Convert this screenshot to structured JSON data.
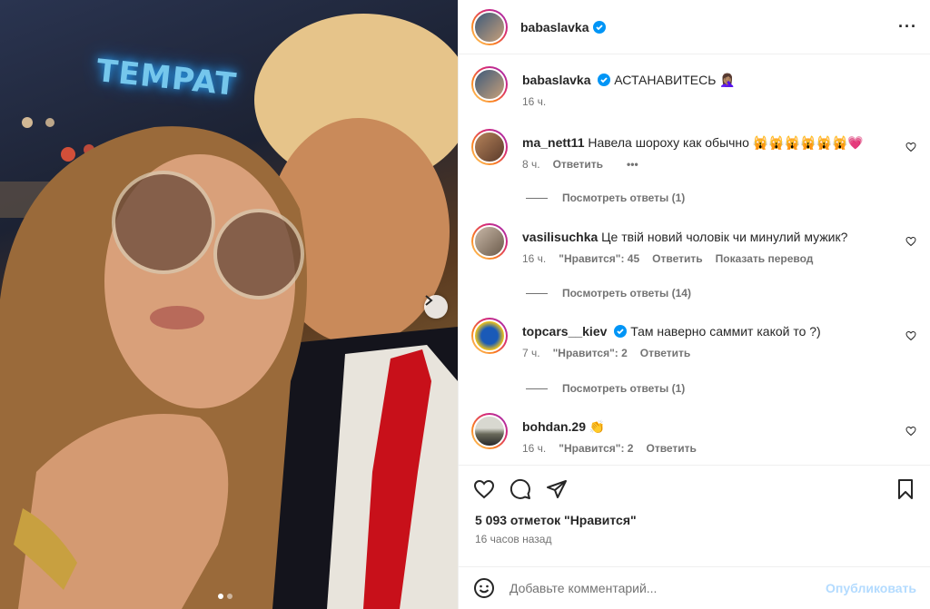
{
  "post": {
    "username": "babaslavka",
    "caption": "АСТАНАВИТЕСЬ 🤦🏽‍♀️",
    "caption_time": "16 ч.",
    "sign_text": "TEMPAT"
  },
  "comments": [
    {
      "username": "ma_nett11",
      "text": "Навела шороху как обычно 🙀🙀🙀🙀🙀🙀💗",
      "time": "8 ч.",
      "likes": "",
      "reply": "Ответить",
      "more": "•••",
      "verified": false,
      "replies": "Посмотреть ответы (1)"
    },
    {
      "username": "vasilisuchka",
      "text": "Це твій новий чоловік чи минулий мужик?",
      "time": "16 ч.",
      "likes": "\"Нравится\": 45",
      "reply": "Ответить",
      "translate": "Показать перевод",
      "verified": false,
      "replies": "Посмотреть ответы (14)"
    },
    {
      "username": "topcars__kiev",
      "text": "Там наверно саммит какой то ?)",
      "time": "7 ч.",
      "likes": "\"Нравится\": 2",
      "reply": "Ответить",
      "verified": true,
      "replies": "Посмотреть ответы (1)"
    },
    {
      "username": "bohdan.29",
      "text": "👏",
      "time": "16 ч.",
      "likes": "\"Нравится\": 2",
      "reply": "Ответить",
      "verified": false
    }
  ],
  "stats": {
    "likes": "5 093 отметок \"Нравится\"",
    "posted": "16 часов назад"
  },
  "composer": {
    "placeholder": "Добавьте комментарий...",
    "post_label": "Опубликовать"
  },
  "carousel": {
    "current": 1,
    "total": 2
  },
  "colors": {
    "verified": "#0095f6",
    "post_disabled": "#b3dbff"
  }
}
